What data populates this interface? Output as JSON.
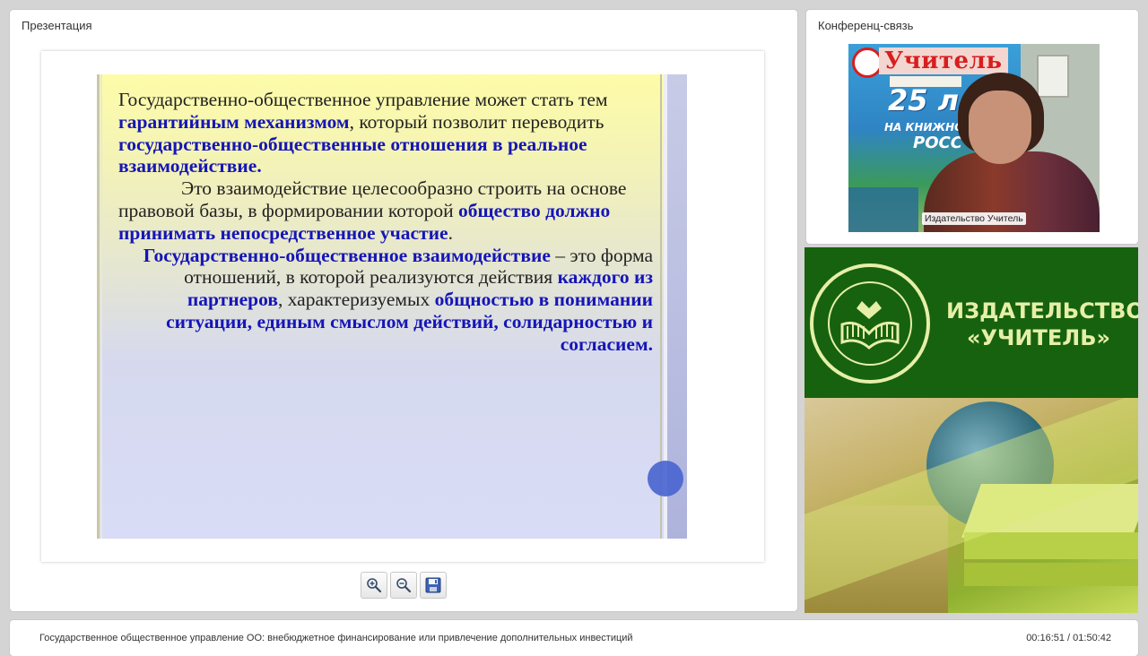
{
  "presentation": {
    "panel_title": "Презентация",
    "slide": {
      "para1": {
        "t1": "Государственно-общественное управление может стать тем ",
        "b1": "гарантийным механизмом",
        "t2": ", который позволит переводить ",
        "b2": "государственно-общественные отношения в реальное взаимодействие."
      },
      "para2": {
        "t1": "Это взаимодействие целесообразно строить на основе правовой базы, в формировании которой ",
        "b1": "общество должно принимать непосредственное участие",
        "t2": "."
      },
      "para3": {
        "b1": "Государственно-общественное взаимодействие",
        "t1": " – это форма отношений, в которой реализуются действия ",
        "b2": "каждого из партнеров",
        "t2": ", характеризуемых ",
        "b3": "общностью в понимании ситуации, единым смыслом действий, солидарностью и согласием."
      }
    },
    "toolbar": {
      "zoom_in": "zoom-in-icon",
      "zoom_out": "zoom-out-icon",
      "save": "save-icon"
    }
  },
  "conference": {
    "panel_title": "Конференц-связь",
    "video_label": "Издательство Учитель",
    "poster": {
      "title": "Учитель",
      "years": "25 лет",
      "line1": "НА КНИЖНОМ Р",
      "line2": "РОСС"
    }
  },
  "brand": {
    "name_line1": "ИЗДАТЕЛЬСТВО",
    "name_line2": "«УЧИТЕЛЬ»",
    "color_green": "#17620f",
    "color_text": "#e6efa8"
  },
  "footer": {
    "title": "Государственное общественное управление ОО: внебюджетное финансирование или привлечение дополнительных инвестиций",
    "time": "00:16:51 / 01:50:42"
  }
}
